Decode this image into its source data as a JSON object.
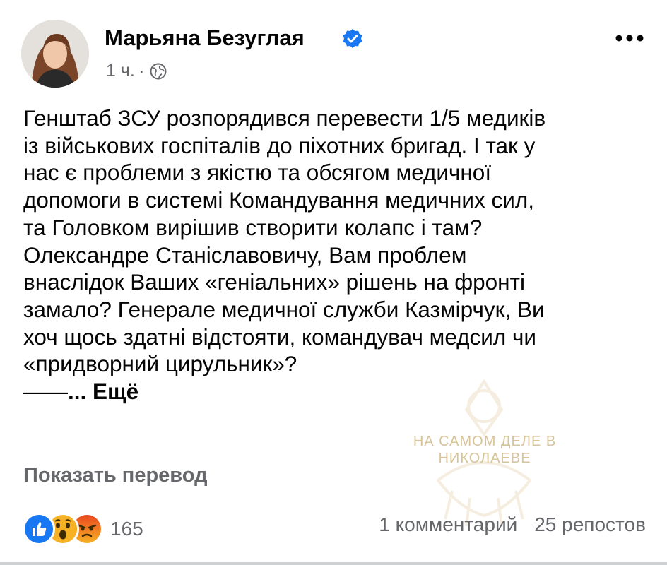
{
  "author": {
    "name": "Марьяна Безуглая",
    "verified": true
  },
  "meta": {
    "time": "1 ч.",
    "separator": "·",
    "audience_icon": "globe-icon"
  },
  "post": {
    "lines": [
      "Генштаб ЗСУ розпорядився перевести 1/5 медиків",
      "із військових госпіталів до піхотних бригад. І так у",
      "нас є проблеми з якістю та обсягом медичної",
      "допомоги в системі Командування медичних сил,",
      "та Головком вирішив створити колапс і там?",
      "Олександре Станіславовичу, Вам проблем",
      "внаслідок Ваших «геніальних» рішень на фронті",
      "замало? Генерале медичної служби Казмірчук, Ви",
      "хоч щось здатні відстояти, командувач медсил чи",
      "«придворний цирульник»?"
    ],
    "tail_dash": "——",
    "see_more": "... Ещё"
  },
  "translate_label": "Показать перевод",
  "reactions": {
    "icons": [
      "like-icon",
      "wow-icon",
      "angry-icon"
    ],
    "count": "165"
  },
  "stats": {
    "comments": "1 комментарий",
    "shares": "25 репостов"
  },
  "watermark": {
    "line1": "НА САМОМ ДЕЛЕ В",
    "line2": "НИКОЛАЕВЕ"
  },
  "colors": {
    "text": "#050505",
    "secondary": "#65676b",
    "facebook_blue": "#1877f2",
    "angry_red": "#e9710f"
  }
}
